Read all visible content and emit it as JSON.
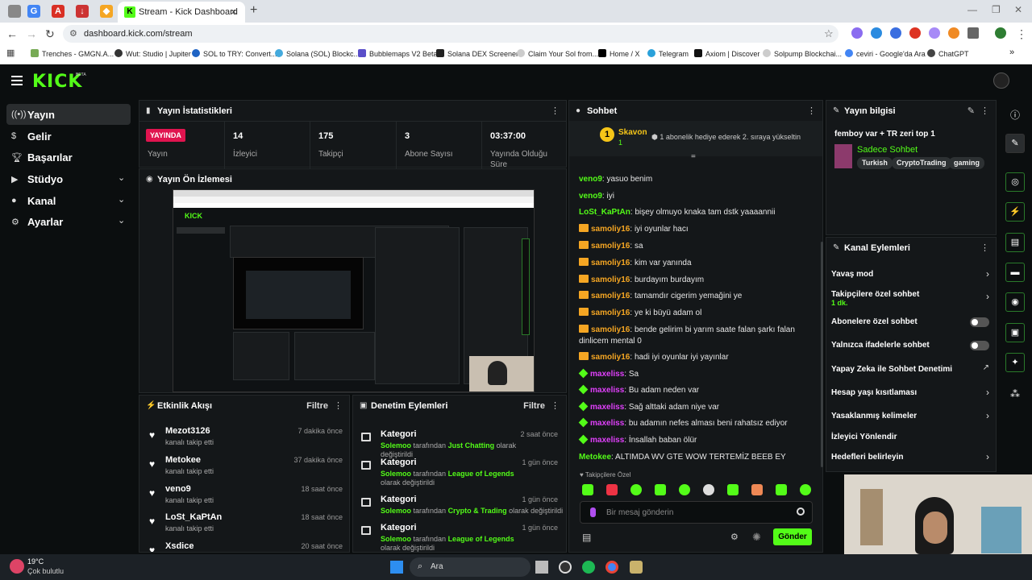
{
  "browser": {
    "active_tab": "Stream - Kick Dashboard",
    "url": "dashboard.kick.com/stream",
    "bookmarks": [
      "Trenches - GMGN.A...",
      "Wut: Studio | Jupiter",
      "SOL to TRY: Convert...",
      "Solana (SOL) Blockc...",
      "Bubblemaps V2 Beta",
      "Solana DEX Screener",
      "Claim Your Sol from...",
      "Home / X",
      "Telegram",
      "Axiom | Discover",
      "Solpump Blockchai...",
      "ceviri - Google'da Ara",
      "ChatGPT"
    ]
  },
  "header": {
    "logo": "KICK",
    "beta": "BETA"
  },
  "sidebar": {
    "items": [
      {
        "label": "Yayın",
        "icon": "broadcast-icon",
        "chevron": false
      },
      {
        "label": "Gelir",
        "icon": "dollar-icon",
        "chevron": false
      },
      {
        "label": "Başarılar",
        "icon": "trophy-icon",
        "chevron": false
      },
      {
        "label": "Stüdyo",
        "icon": "video-icon",
        "chevron": true
      },
      {
        "label": "Kanal",
        "icon": "user-icon",
        "chevron": true
      },
      {
        "label": "Ayarlar",
        "icon": "gear-icon",
        "chevron": true
      }
    ]
  },
  "stats": {
    "title": "Yayın İstatistikleri",
    "live_badge": "YAYINDA",
    "live_label": "Yayın",
    "viewers": {
      "value": "14",
      "label": "İzleyici"
    },
    "followers": {
      "value": "175",
      "label": "Takipçi"
    },
    "subs": {
      "value": "3",
      "label": "Abone Sayısı"
    },
    "uptime": {
      "value": "03:37:00",
      "label": "Yayında Olduğu Süre"
    }
  },
  "preview": {
    "title": "Yayın Ön İzlemesi"
  },
  "activity": {
    "title": "Etkinlik Akışı",
    "filter": "Filtre",
    "items": [
      {
        "name": "Mezot3126",
        "sub": "kanalı takip etti",
        "time": "7 dakika önce"
      },
      {
        "name": "Metokee",
        "sub": "kanalı takip etti",
        "time": "37 dakika önce"
      },
      {
        "name": "veno9",
        "sub": "kanalı takip etti",
        "time": "18 saat önce"
      },
      {
        "name": "LoSt_KaPtAn",
        "sub": "kanalı takip etti",
        "time": "18 saat önce"
      },
      {
        "name": "Xsdice",
        "sub": "",
        "time": "20 saat önce"
      }
    ]
  },
  "moderation": {
    "title": "Denetim Eylemleri",
    "filter": "Filtre",
    "items": [
      {
        "name": "Kategori",
        "actor": "Solemoo",
        "mid": " tarafından ",
        "target": "Just Chatting",
        "end": " olarak değiştirildi",
        "time": "2 saat önce"
      },
      {
        "name": "Kategori",
        "actor": "Solemoo",
        "mid": " tarafından ",
        "target": "League of Legends",
        "end": " olarak değiştirildi",
        "time": "1 gün önce"
      },
      {
        "name": "Kategori",
        "actor": "Solemoo",
        "mid": " tarafından ",
        "target": "Crypto & Trading",
        "end": " olarak değiştirildi",
        "time": "1 gün önce"
      },
      {
        "name": "Kategori",
        "actor": "Solemoo",
        "mid": " tarafından ",
        "target": "League of Legends",
        "end": " olarak değiştirildi",
        "time": "1 gün önce"
      }
    ]
  },
  "chat": {
    "title": "Sohbet",
    "gift_user": "Skavon",
    "gift_rank": "1",
    "gift_count": "1",
    "gift_text": "1 abonelik hediye ederek 2. sıraya yükseltin",
    "messages": [
      {
        "user": "veno9",
        "color": "#53fc18",
        "badge": "",
        "text": "yasuo benim"
      },
      {
        "user": "veno9",
        "color": "#53fc18",
        "badge": "",
        "text": "iyi"
      },
      {
        "user": "LoSt_KaPtAn",
        "color": "#53fc18",
        "badge": "",
        "text": "bişey olmuyo knaka tam dstk yaaaannii"
      },
      {
        "user": "samoliy16",
        "color": "#f5a623",
        "badge": "crown",
        "text": "iyi oyunlar hacı"
      },
      {
        "user": "samoliy16",
        "color": "#f5a623",
        "badge": "crown",
        "text": "sa"
      },
      {
        "user": "samoliy16",
        "color": "#f5a623",
        "badge": "crown",
        "text": "kim var yanında"
      },
      {
        "user": "samoliy16",
        "color": "#f5a623",
        "badge": "crown",
        "text": "burdayım burdayım"
      },
      {
        "user": "samoliy16",
        "color": "#f5a623",
        "badge": "crown",
        "text": "tamamdır cigerim yemağini ye"
      },
      {
        "user": "samoliy16",
        "color": "#f5a623",
        "badge": "crown",
        "text": "ye ki büyü adam ol"
      },
      {
        "user": "samoliy16",
        "color": "#f5a623",
        "badge": "crown",
        "text": "bende gelirim bi yarım saate falan şarkı falan dinlicem mental 0"
      },
      {
        "user": "samoliy16",
        "color": "#f5a623",
        "badge": "crown",
        "text": "hadi iyi oyunlar iyi yayınlar"
      },
      {
        "user": "maxeliss",
        "color": "#e040fb",
        "badge": "gem",
        "text": "Sa"
      },
      {
        "user": "maxeliss",
        "color": "#e040fb",
        "badge": "gem",
        "text": "Bu adam neden var"
      },
      {
        "user": "maxeliss",
        "color": "#e040fb",
        "badge": "gem",
        "text": "Sağ alttaki adam niye var"
      },
      {
        "user": "maxeliss",
        "color": "#e040fb",
        "badge": "gem",
        "text": "bu adamın nefes alması beni rahatsız ediyor"
      },
      {
        "user": "maxeliss",
        "color": "#e040fb",
        "badge": "gem",
        "text": "İnsallah baban ölür"
      },
      {
        "user": "Metokee",
        "color": "#53fc18",
        "badge": "",
        "text": "ALTIMDA WV GTE WOW TERTEMİZ BEEB EY"
      }
    ],
    "followers_only": "Takipçilere Özel",
    "input_placeholder": "Bir mesaj gönderin",
    "send": "Gönder"
  },
  "info": {
    "title": "Yayın bilgisi",
    "stream_title": "femboy var + TR zeri top 1",
    "category": "Sadece Sohbet",
    "tags": [
      "Turkish",
      "CryptoTrading",
      "gaming"
    ]
  },
  "channel_actions": {
    "title": "Kanal Eylemleri",
    "items": [
      {
        "label": "Yavaş mod",
        "sub": "",
        "control": "chevron"
      },
      {
        "label": "Takipçilere özel sohbet",
        "sub": "1 dk.",
        "control": "chevron"
      },
      {
        "label": "Abonelere özel sohbet",
        "sub": "",
        "control": "toggle"
      },
      {
        "label": "Yalnızca ifadelerle sohbet",
        "sub": "",
        "control": "toggle"
      },
      {
        "label": "Yapay Zeka ile Sohbet Denetimi",
        "sub": "",
        "control": "external"
      },
      {
        "label": "Hesap yaşı kısıtlaması",
        "sub": "",
        "control": "chevron"
      },
      {
        "label": "Yasaklanmış kelimeler",
        "sub": "",
        "control": "chevron"
      },
      {
        "label": "İzleyici Yönlendir",
        "sub": "",
        "control": "none"
      },
      {
        "label": "Hedefleri belirleyin",
        "sub": "",
        "control": "chevron"
      }
    ]
  },
  "taskbar": {
    "weather_temp": "19°C",
    "weather_desc": "Çok bulutlu",
    "search": "Ara"
  },
  "colors": {
    "accent": "#53fc18",
    "live": "#e0144f",
    "bg": "#0b0e0f",
    "panel": "#141719"
  }
}
